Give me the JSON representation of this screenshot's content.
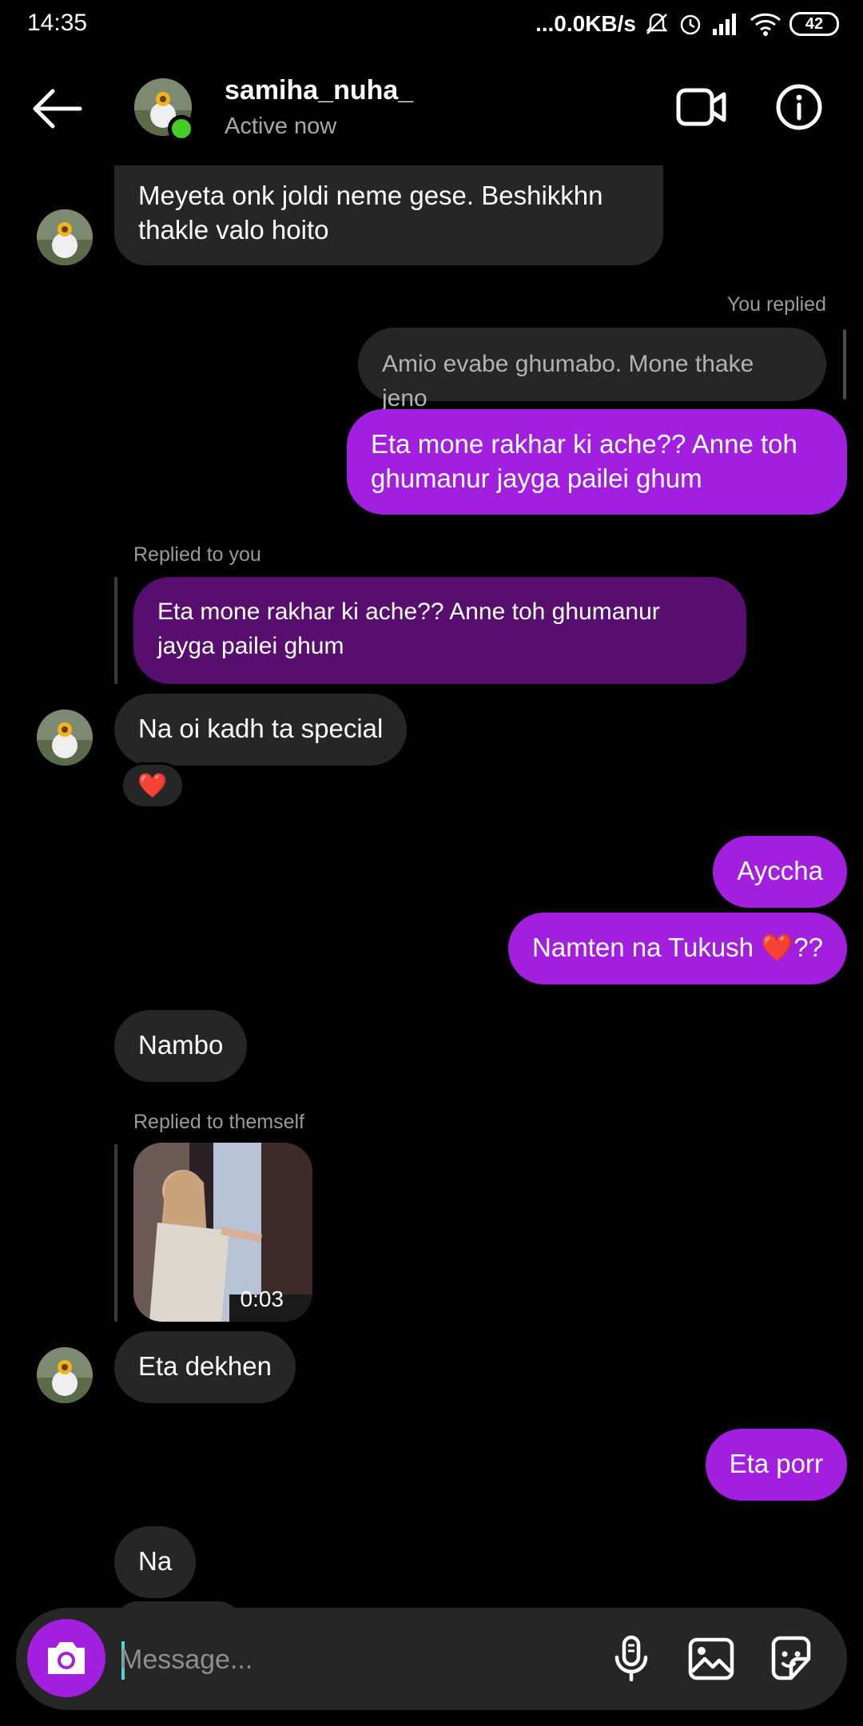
{
  "status_bar": {
    "time": "14:35",
    "network_speed": "...0.0KB/s",
    "battery": "42",
    "icons": [
      "mute-icon",
      "alarm-icon",
      "signal-icon",
      "wifi-icon",
      "battery-icon"
    ]
  },
  "header": {
    "username": "samiha_nuha_",
    "status": "Active now",
    "online_color": "#44cc28"
  },
  "messages": {
    "m1": "Meyeta onk joldi neme gese. Beshikkhn thakle valo hoito",
    "you_replied_label": "You replied",
    "m2_quote": "Amio evabe ghumabo. Mone thake jeno",
    "m2": "Eta mone rakhar ki ache?? Anne toh ghumanur jayga pailei ghum",
    "replied_to_you_label": "Replied to you",
    "m3_quote": "Eta mone rakhar ki ache?? Anne toh ghumanur jayga pailei ghum",
    "m3": "Na oi kadh ta special",
    "m3_reaction": "❤️",
    "m4": "Ayccha",
    "m5": "Namten na Tukush ❤️??",
    "m6": "Nambo",
    "replied_to_themself_label": "Replied to themself",
    "video_duration": "0:03",
    "m7": "Eta dekhen",
    "m8": "Eta porr",
    "m9": "Na"
  },
  "composer": {
    "placeholder": "Message..."
  },
  "colors": {
    "outgoing_bubble": "#a31fe0",
    "incoming_bubble": "#262626",
    "quoted_reply_bubble": "#580e6f",
    "background": "#000000"
  }
}
